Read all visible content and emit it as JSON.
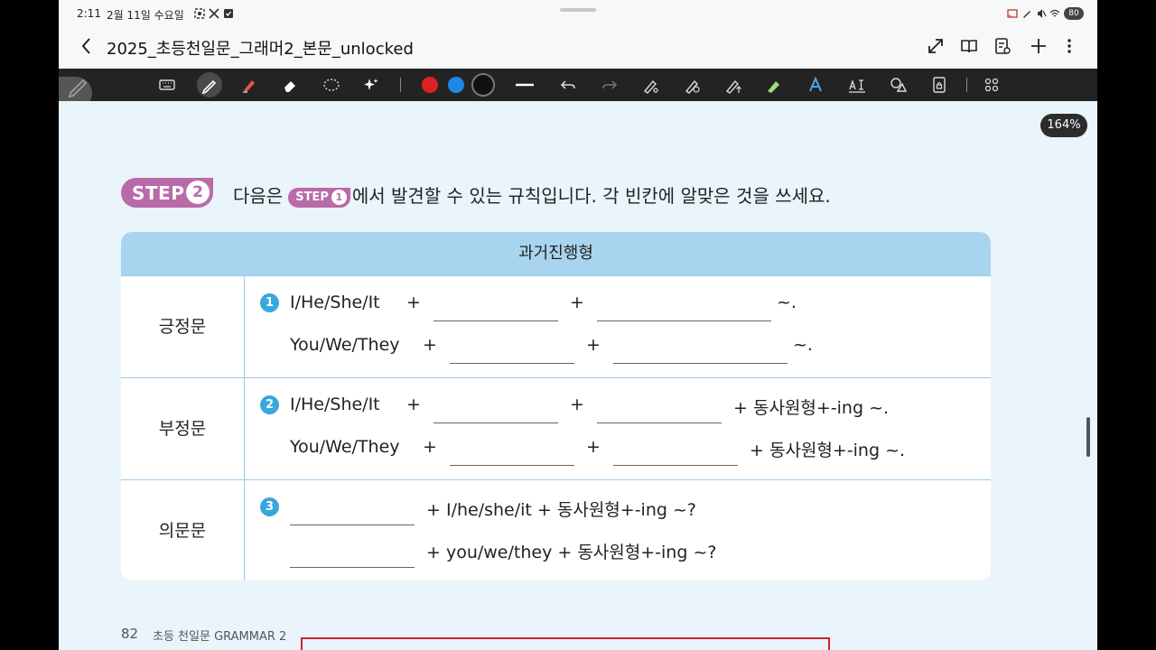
{
  "status_bar": {
    "time": "2:11",
    "date": "2월 11일 수요일",
    "battery": "80"
  },
  "title_bar": {
    "title": "2025_초등천일문_그래머2_본문_unlocked"
  },
  "toolbar": {
    "colors": [
      "#e02020",
      "#1e88e5",
      "#111111"
    ]
  },
  "page": {
    "zoom": "164%",
    "step_badge": {
      "label": "STEP",
      "number": "2"
    },
    "instruction": {
      "before": "다음은",
      "step_label": "STEP",
      "step_num": "1",
      "after": "에서 발견할 수 있는 규칙입니다. 각 빈칸에 알맞은 것을 쓰세요."
    },
    "table": {
      "header": "과거진행형",
      "rows": [
        {
          "label": "긍정문",
          "num": "1",
          "line1": {
            "subject": "I/He/She/It",
            "plus1": "+",
            "plus2": "+",
            "end": "~."
          },
          "line2": {
            "subject": "You/We/They",
            "plus1": "+",
            "plus2": "+",
            "end": "~."
          }
        },
        {
          "label": "부정문",
          "num": "2",
          "line1": {
            "subject": "I/He/She/It",
            "plus1": "+",
            "plus2": "+",
            "end": "+ 동사원형+-ing ~."
          },
          "line2": {
            "subject": "You/We/They",
            "plus1": "+",
            "plus2": "+",
            "end": "+ 동사원형+-ing ~."
          }
        },
        {
          "label": "의문문",
          "num": "3",
          "line1": {
            "text": "+ I/he/she/it + 동사원형+-ing ~?"
          },
          "line2": {
            "text": "+ you/we/they + 동사원형+-ing ~?"
          }
        }
      ]
    },
    "footer": {
      "page_number": "82",
      "book_title": "초등 천일문 GRAMMAR 2"
    }
  }
}
